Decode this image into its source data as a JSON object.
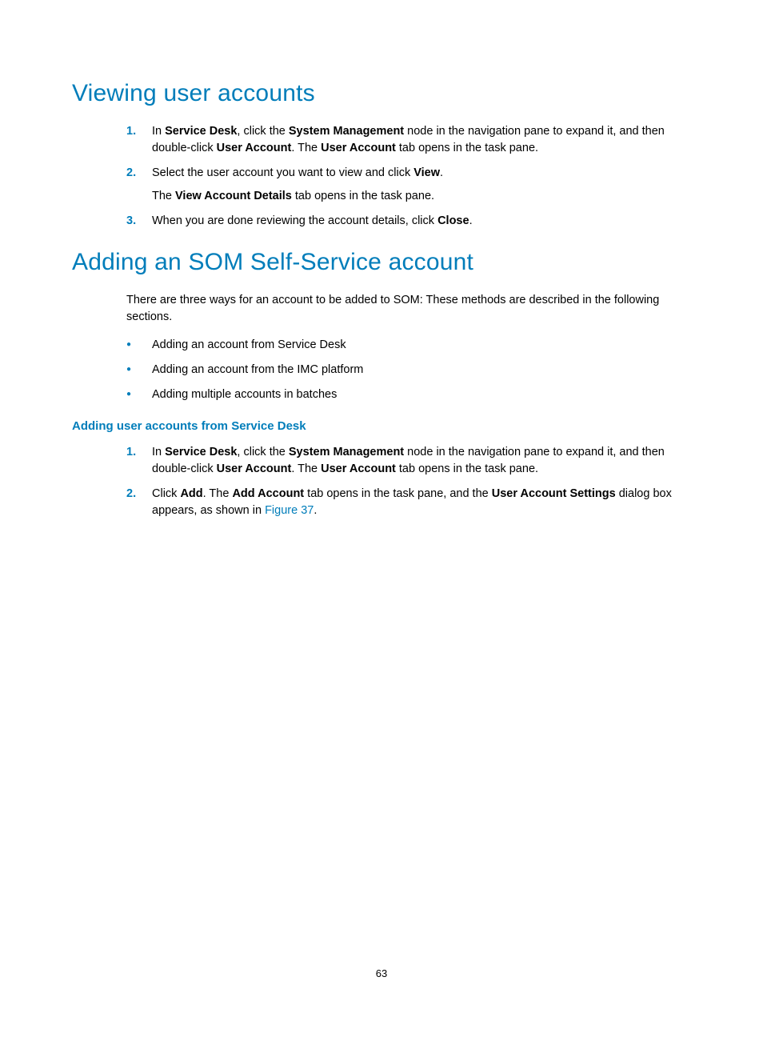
{
  "section1": {
    "heading": "Viewing user accounts",
    "steps": [
      {
        "num": "1.",
        "parts": [
          {
            "t": "In "
          },
          {
            "t": "Service Desk",
            "b": true
          },
          {
            "t": ", click the "
          },
          {
            "t": "System Management",
            "b": true
          },
          {
            "t": " node in the navigation pane to expand it, and then double-click "
          },
          {
            "t": "User Account",
            "b": true
          },
          {
            "t": ". The "
          },
          {
            "t": "User Account",
            "b": true
          },
          {
            "t": " tab opens in the task pane."
          }
        ]
      },
      {
        "num": "2.",
        "parts": [
          {
            "t": "Select the user account you want to view and click "
          },
          {
            "t": "View",
            "b": true
          },
          {
            "t": "."
          }
        ],
        "after": [
          {
            "t": "The "
          },
          {
            "t": "View Account Details",
            "b": true
          },
          {
            "t": " tab opens in the task pane."
          }
        ]
      },
      {
        "num": "3.",
        "parts": [
          {
            "t": "When you are done reviewing the account details, click "
          },
          {
            "t": "Close",
            "b": true
          },
          {
            "t": "."
          }
        ]
      }
    ]
  },
  "section2": {
    "heading": "Adding an SOM Self-Service account",
    "intro": "There are three ways for an account to be added to SOM: These methods are described in the following sections.",
    "bullets": [
      "Adding an account from Service Desk",
      "Adding an account from the IMC platform",
      "Adding multiple accounts in batches"
    ],
    "subheading": "Adding user accounts from Service Desk",
    "substeps": [
      {
        "num": "1.",
        "parts": [
          {
            "t": "In "
          },
          {
            "t": "Service Desk",
            "b": true
          },
          {
            "t": ", click the "
          },
          {
            "t": "System Management",
            "b": true
          },
          {
            "t": " node in the navigation pane to expand it, and then double-click "
          },
          {
            "t": "User Account",
            "b": true
          },
          {
            "t": ". The "
          },
          {
            "t": "User Account",
            "b": true
          },
          {
            "t": " tab opens in the task pane."
          }
        ]
      },
      {
        "num": "2.",
        "parts": [
          {
            "t": "Click "
          },
          {
            "t": "Add",
            "b": true
          },
          {
            "t": ". The "
          },
          {
            "t": "Add Account",
            "b": true
          },
          {
            "t": " tab opens in the task pane, and the "
          },
          {
            "t": "User Account Settings",
            "b": true
          },
          {
            "t": " dialog box appears, as shown in "
          },
          {
            "t": "Figure 37",
            "link": true
          },
          {
            "t": "."
          }
        ]
      }
    ]
  },
  "pageNumber": "63"
}
